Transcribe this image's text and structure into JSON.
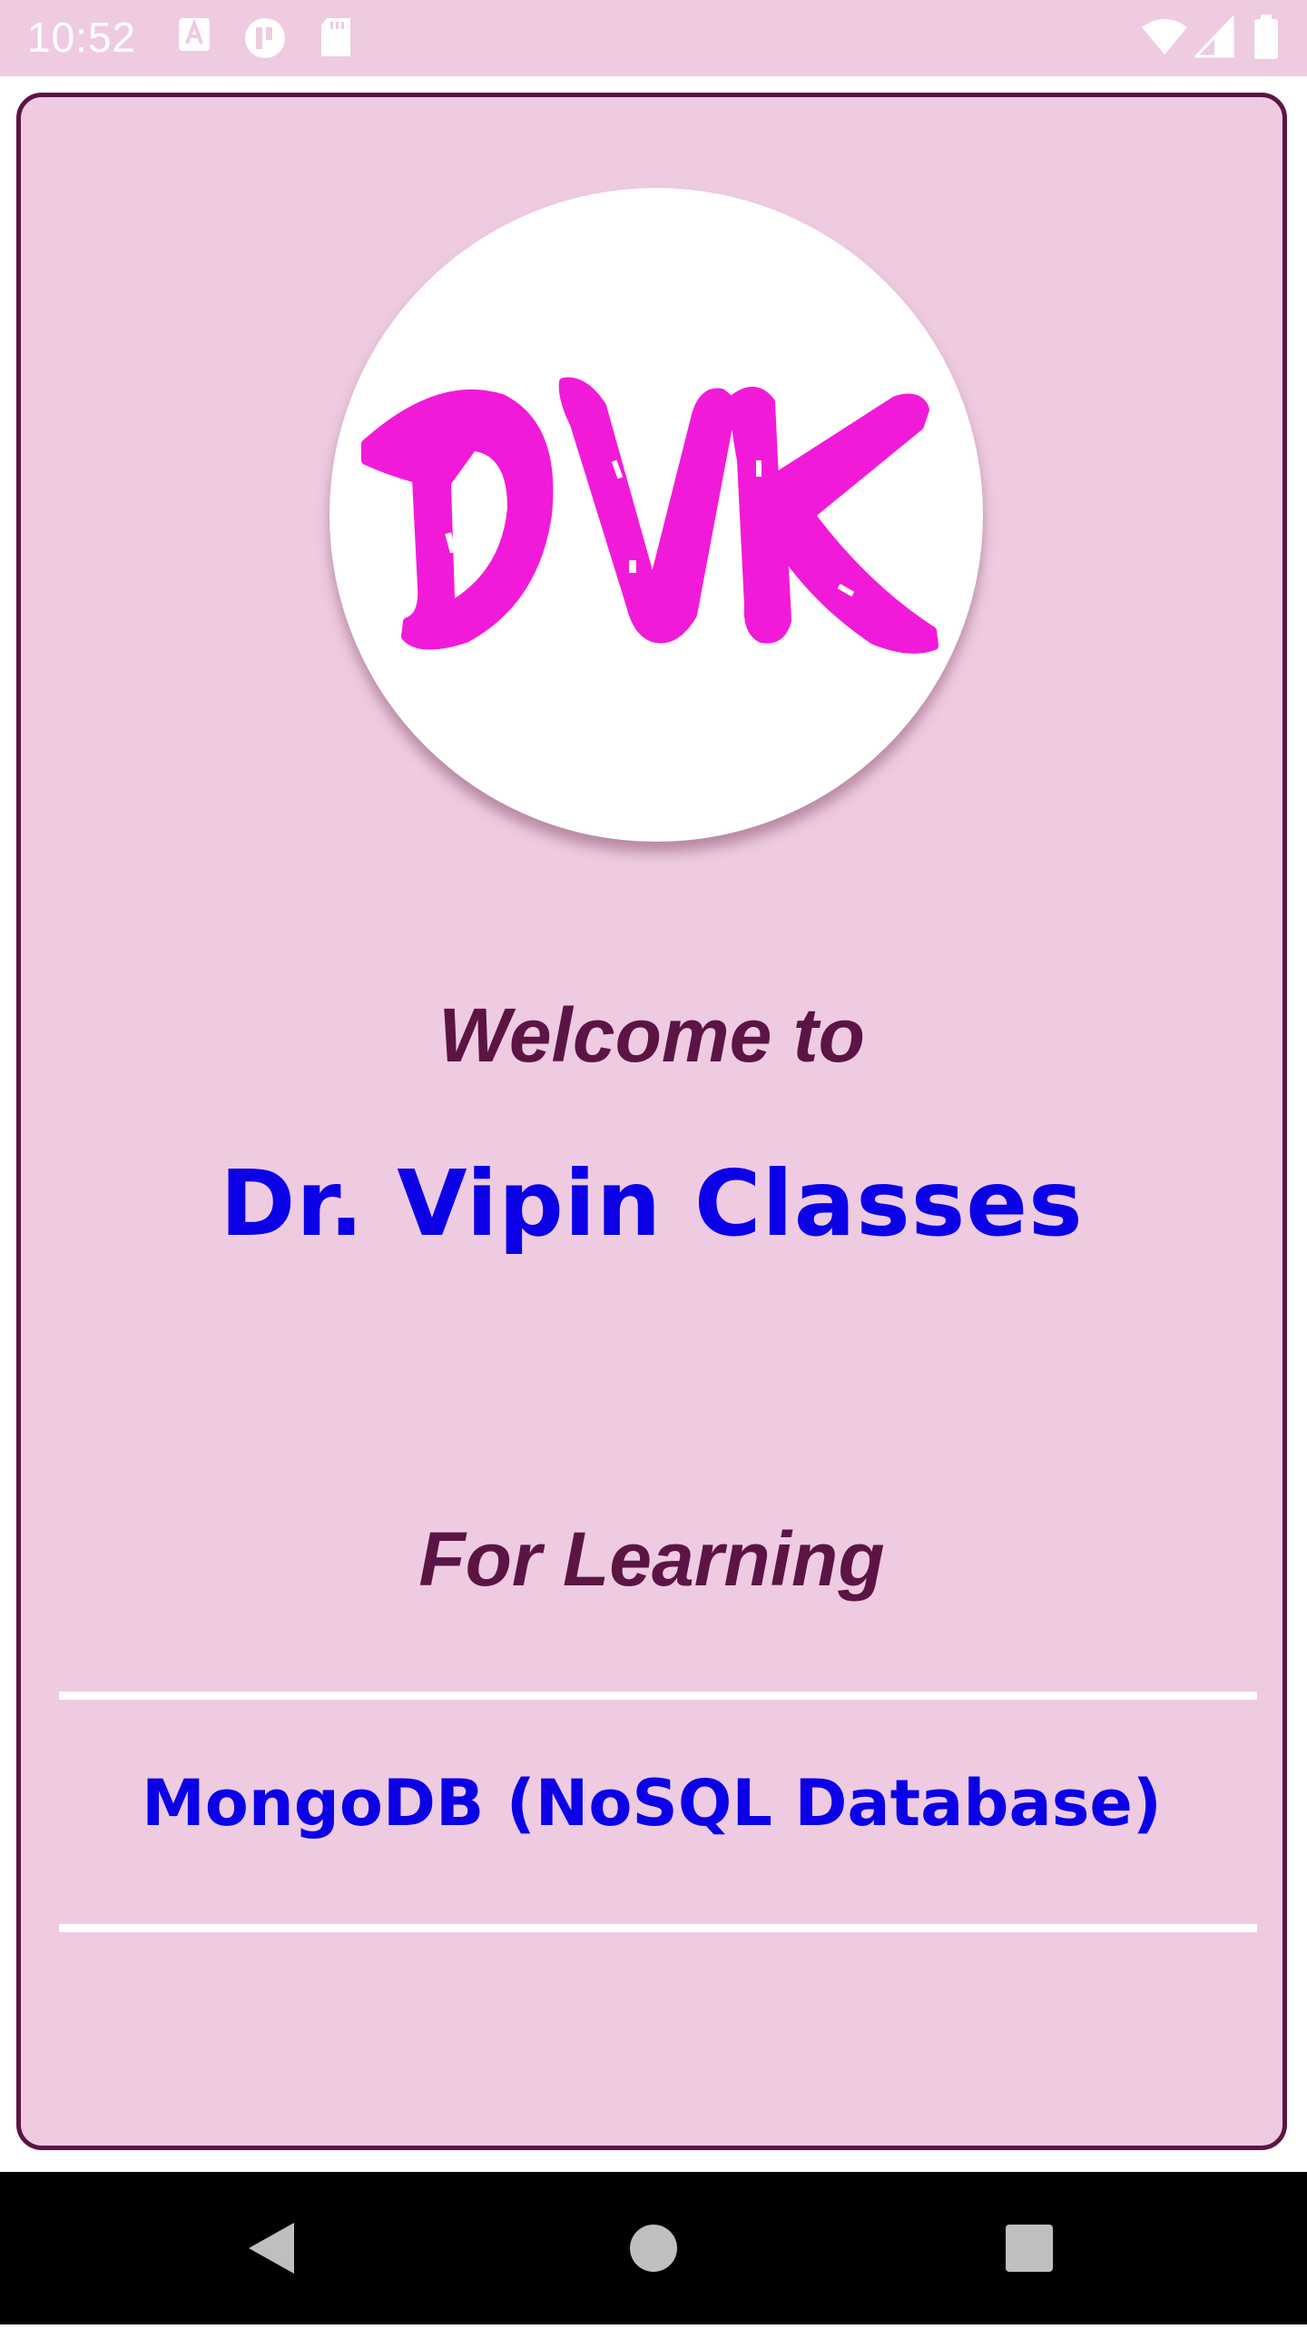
{
  "status_bar": {
    "time": "10:52",
    "icons": [
      "a11y-a-icon",
      "t-circle-icon",
      "sd-card-icon",
      "wifi-icon",
      "signal-icon",
      "battery-icon"
    ]
  },
  "logo": {
    "text": "DVK",
    "color": "#f21ad9"
  },
  "main": {
    "welcome_text": "Welcome to",
    "brand_name": "Dr. Vipin Classes",
    "for_learning": "For Learning",
    "course_title": "MongoDB (NoSQL Database)"
  },
  "colors": {
    "background": "#eecbe1",
    "border": "#5c1445",
    "heading": "#5c1445",
    "accent_blue": "#0b00e6",
    "logo_pink": "#f21ad9"
  },
  "nav_bar": {
    "icons": [
      "back-icon",
      "home-icon",
      "recents-icon"
    ]
  }
}
